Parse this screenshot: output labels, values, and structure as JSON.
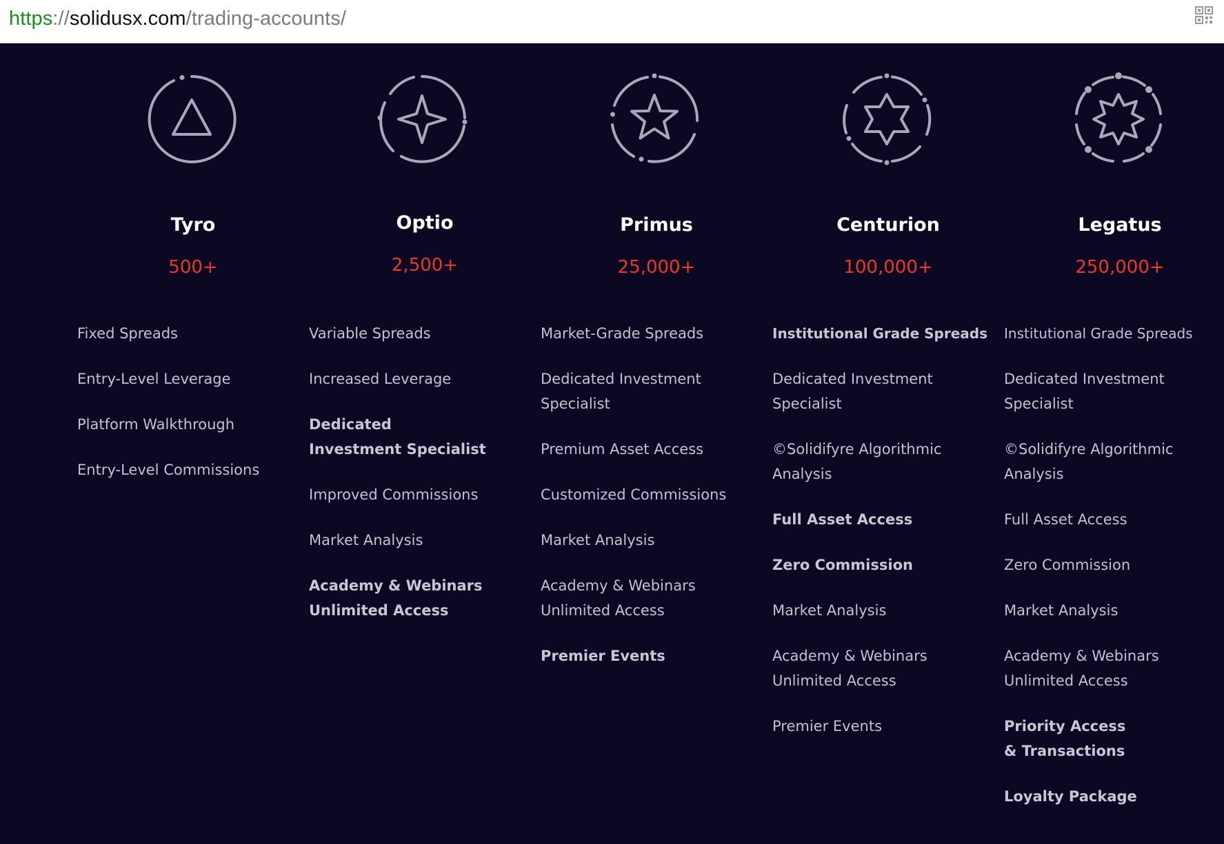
{
  "browser": {
    "url": {
      "scheme": "https",
      "separator": "://",
      "host": "solidusx.com",
      "path": "/trading-accounts/"
    },
    "qr_icon": "qr-code-icon"
  },
  "colors": {
    "background": "#0c0722",
    "accent_red": "#e8392d",
    "icon_stroke": "#aaa7b8",
    "feature_text": "#c4c2d2"
  },
  "tiers": [
    {
      "name": "Tyro",
      "min_deposit": "500+",
      "icon": "triangle-badge-icon",
      "features": [
        {
          "text": "Fixed Spreads",
          "bold": false
        },
        {
          "text": "Entry-Level Leverage",
          "bold": false
        },
        {
          "text": "Platform Walkthrough",
          "bold": false
        },
        {
          "text": "Entry-Level Commissions",
          "bold": false
        }
      ]
    },
    {
      "name": "Optio",
      "min_deposit": "2,500+",
      "icon": "four-point-star-badge-icon",
      "features": [
        {
          "text": "Variable Spreads",
          "bold": false
        },
        {
          "text": "Increased Leverage",
          "bold": false
        },
        {
          "text": "Dedicated Investment Specialist",
          "bold": true
        },
        {
          "text": "Improved Commissions",
          "bold": false
        },
        {
          "text": "Market Analysis",
          "bold": false
        },
        {
          "text": "Academy & Webinars Unlimited Access",
          "bold": true
        }
      ]
    },
    {
      "name": "Primus",
      "min_deposit": "25,000+",
      "icon": "star-badge-icon",
      "features": [
        {
          "text": "Market-Grade Spreads",
          "bold": false
        },
        {
          "text": "Dedicated Investment Specialist",
          "bold": false
        },
        {
          "text": "Premium Asset Access",
          "bold": false
        },
        {
          "text": "Customized Commissions",
          "bold": false
        },
        {
          "text": "Market Analysis",
          "bold": false
        },
        {
          "text": "Academy & Webinars Unlimited Access",
          "bold": false
        },
        {
          "text": "Premier Events",
          "bold": true
        }
      ]
    },
    {
      "name": "Centurion",
      "min_deposit": "100,000+",
      "icon": "six-point-star-badge-icon",
      "features": [
        {
          "text": "Institutional Grade Spreads",
          "bold": true
        },
        {
          "text": "Dedicated Investment Specialist",
          "bold": false
        },
        {
          "text": "©Solidifyre Algorithmic Analysis",
          "bold": false
        },
        {
          "text": "Full Asset Access",
          "bold": true
        },
        {
          "text": "Zero Commission",
          "bold": true
        },
        {
          "text": "Market Analysis",
          "bold": false
        },
        {
          "text": "Academy & Webinars Unlimited Access",
          "bold": false
        },
        {
          "text": "Premier Events",
          "bold": false
        }
      ]
    },
    {
      "name": "Legatus",
      "min_deposit": "250,000+",
      "icon": "eight-point-star-badge-icon",
      "features": [
        {
          "text": "Institutional Grade Spreads",
          "bold": false
        },
        {
          "text": "Dedicated Investment Specialist",
          "bold": false
        },
        {
          "text": "©Solidifyre Algorithmic Analysis",
          "bold": false
        },
        {
          "text": "Full Asset Access",
          "bold": false
        },
        {
          "text": "Zero Commission",
          "bold": false
        },
        {
          "text": "Market Analysis",
          "bold": false
        },
        {
          "text": "Academy & Webinars Unlimited Access",
          "bold": false
        },
        {
          "text": "Priority Access & Transactions",
          "bold": true
        },
        {
          "text": "Loyalty Package",
          "bold": true
        }
      ]
    }
  ]
}
